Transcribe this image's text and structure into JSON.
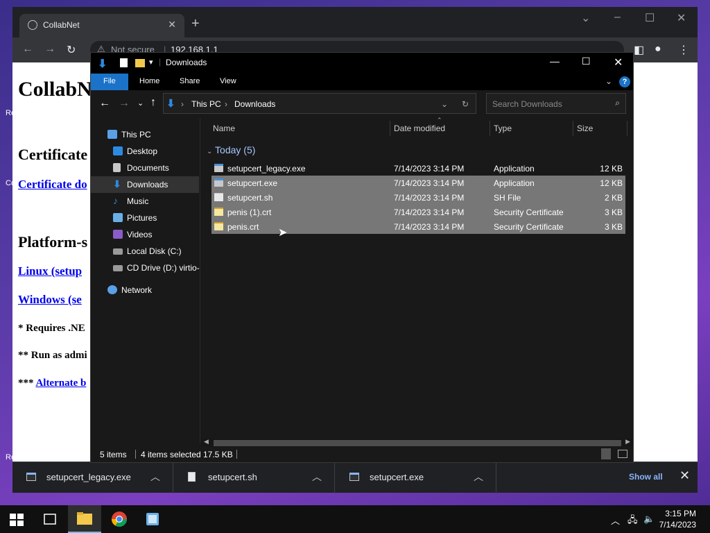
{
  "desktop": {
    "edge_labels": [
      "Re",
      "Co",
      "Re"
    ]
  },
  "chrome": {
    "tab_title": "CollabNet",
    "address": {
      "security": "Not secure",
      "url": "192.168.1.1"
    },
    "page": {
      "heading": "CollabN",
      "section1": "Certificate",
      "link1": "Certificate do",
      "section2": "Platform-s",
      "link_linux": "Linux (setup",
      "link_windows": "Windows (se",
      "note1": "* Requires .NE",
      "note2": "** Run as admi",
      "note3_prefix": "***",
      "note3_link": "Alternate b"
    },
    "downloads_bar": {
      "items": [
        {
          "name": "setupcert_legacy.exe",
          "icon": "exe-icon"
        },
        {
          "name": "setupcert.sh",
          "icon": "document-icon"
        },
        {
          "name": "setupcert.exe",
          "icon": "exe-icon"
        }
      ],
      "show_all": "Show all"
    }
  },
  "explorer": {
    "title": "Downloads",
    "ribbon_tabs": [
      "File",
      "Home",
      "Share",
      "View"
    ],
    "breadcrumb": [
      "This PC",
      "Downloads"
    ],
    "search_placeholder": "Search Downloads",
    "nav": [
      {
        "label": "This PC",
        "icon": "pc-icon",
        "color": "#5aa0e6"
      },
      {
        "label": "Desktop",
        "icon": "desktop-icon",
        "color": "#2d8ae0"
      },
      {
        "label": "Documents",
        "icon": "documents-icon",
        "color": "#c8c8c8"
      },
      {
        "label": "Downloads",
        "icon": "download-icon",
        "color": "#2d8ae0"
      },
      {
        "label": "Music",
        "icon": "music-icon",
        "color": "#2d8ae0"
      },
      {
        "label": "Pictures",
        "icon": "pictures-icon",
        "color": "#6ab0e8"
      },
      {
        "label": "Videos",
        "icon": "videos-icon",
        "color": "#8a5cc9"
      },
      {
        "label": "Local Disk (C:)",
        "icon": "disk-icon",
        "color": "#9a9a9a"
      },
      {
        "label": "CD Drive (D:) virtio-",
        "icon": "cd-drive-icon",
        "color": "#9a9a9a"
      },
      {
        "label": "Network",
        "icon": "network-icon",
        "color": "#5aa0e6"
      }
    ],
    "columns": [
      "Name",
      "Date modified",
      "Type",
      "Size"
    ],
    "group": "Today (5)",
    "files": [
      {
        "name": "setupcert_legacy.exe",
        "date": "7/14/2023 3:14 PM",
        "type": "Application",
        "size": "12 KB",
        "selected": false,
        "kind": "exe"
      },
      {
        "name": "setupcert.exe",
        "date": "7/14/2023 3:14 PM",
        "type": "Application",
        "size": "12 KB",
        "selected": true,
        "kind": "exe"
      },
      {
        "name": "setupcert.sh",
        "date": "7/14/2023 3:14 PM",
        "type": "SH File",
        "size": "2 KB",
        "selected": true,
        "kind": "sh"
      },
      {
        "name": "penis (1).crt",
        "date": "7/14/2023 3:14 PM",
        "type": "Security Certificate",
        "size": "3 KB",
        "selected": true,
        "kind": "crt"
      },
      {
        "name": "penis.crt",
        "date": "7/14/2023 3:14 PM",
        "type": "Security Certificate",
        "size": "3 KB",
        "selected": true,
        "kind": "crt"
      }
    ],
    "status": {
      "items": "5 items",
      "selected": "4 items selected",
      "size": "17.5 KB"
    }
  },
  "taskbar": {
    "time": "3:15 PM",
    "date": "7/14/2023"
  },
  "colors": {
    "accent": "#1a73c9",
    "chrome_bg": "#202124",
    "explorer_bg": "#191919",
    "selection": "#777777"
  }
}
